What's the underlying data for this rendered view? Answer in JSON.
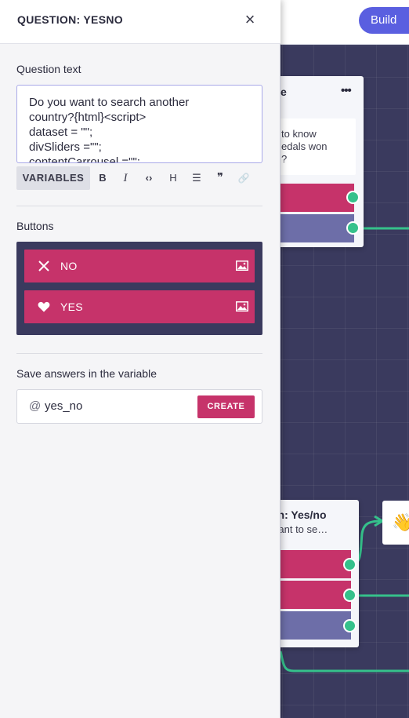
{
  "topbar": {
    "build_label": "Build"
  },
  "canvas": {
    "node_top": {
      "title_fragment": "e",
      "text_lines": [
        "to know",
        "edals won",
        "?"
      ]
    },
    "node_bottom": {
      "title_fragment": "on: Yes/no",
      "subtitle_fragment": "want to se…"
    },
    "wave_node": {
      "emoji": "👋"
    }
  },
  "panel": {
    "title": "QUESTION: YESNO",
    "close_glyph": "×",
    "question_label": "Question text",
    "question_text": "Do you want to search another\ncountry?{html}<script>\ndataset = \"\";\ndivSliders =\"\";\ncontentCarrousel =\"\";",
    "toolbar": {
      "variables_label": "VARIABLES",
      "bold_glyph": "B",
      "italic_glyph": "I",
      "code_glyph": "‹›",
      "heading_glyph": "H",
      "list_glyph": "☰",
      "quote_glyph": "❞",
      "link_glyph": "🔗"
    },
    "buttons_label": "Buttons",
    "buttons": [
      {
        "label": "NO",
        "icon": "x-icon"
      },
      {
        "label": "YES",
        "icon": "heart-icon"
      }
    ],
    "save_label": "Save answers in the variable",
    "variable": {
      "at": "@",
      "value": "yes_no"
    },
    "create_label": "CREATE"
  },
  "colors": {
    "accent_pink": "#c6336a",
    "accent_purple": "#6d6ea8",
    "build_blue": "#5a5fe0",
    "port_green": "#35c18b",
    "canvas_bg": "#3a3a5e"
  }
}
